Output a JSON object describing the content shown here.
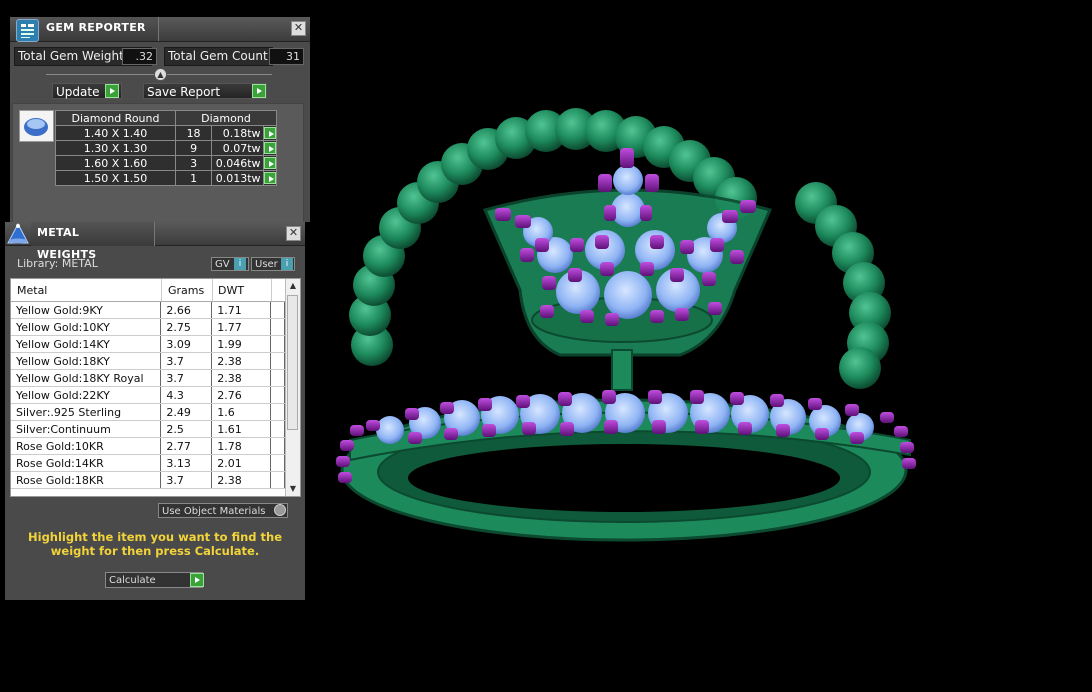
{
  "gem_reporter": {
    "title": "GEM REPORTER",
    "total_weight_label": "Total Gem Weight",
    "total_weight_value": ".32",
    "total_count_label": "Total Gem Count",
    "total_count_value": "31",
    "update_label": "Update",
    "save_label": "Save Report",
    "gem_shape": "Diamond Round",
    "gem_material": "Diamond",
    "rows": [
      {
        "size": "1.40 X 1.40",
        "count": "18",
        "weight": "0.18tw"
      },
      {
        "size": "1.30 X 1.30",
        "count": "9",
        "weight": "0.07tw"
      },
      {
        "size": "1.60 X 1.60",
        "count": "3",
        "weight": "0.046tw"
      },
      {
        "size": "1.50 X 1.50",
        "count": "1",
        "weight": "0.013tw"
      }
    ]
  },
  "metal_weights": {
    "title": "METAL WEIGHTS",
    "library_label": "Library: METAL",
    "gv_label": "GV",
    "user_label": "User",
    "columns": {
      "metal": "Metal",
      "grams": "Grams",
      "dwt": "DWT"
    },
    "rows": [
      {
        "metal": "Yellow Gold:9KY",
        "grams": "2.66",
        "dwt": "1.71"
      },
      {
        "metal": "Yellow Gold:10KY",
        "grams": "2.75",
        "dwt": "1.77"
      },
      {
        "metal": "Yellow Gold:14KY",
        "grams": "3.09",
        "dwt": "1.99"
      },
      {
        "metal": "Yellow Gold:18KY",
        "grams": "3.7",
        "dwt": "2.38"
      },
      {
        "metal": "Yellow Gold:18KY Royal",
        "grams": "3.7",
        "dwt": "2.38"
      },
      {
        "metal": "Yellow Gold:22KY",
        "grams": "4.3",
        "dwt": "2.76"
      },
      {
        "metal": "Silver:.925 Sterling",
        "grams": "2.49",
        "dwt": "1.6"
      },
      {
        "metal": "Silver:Continuum",
        "grams": "2.5",
        "dwt": "1.61"
      },
      {
        "metal": "Rose Gold:10KR",
        "grams": "2.77",
        "dwt": "1.78"
      },
      {
        "metal": "Rose Gold:14KR",
        "grams": "3.13",
        "dwt": "2.01"
      },
      {
        "metal": "Rose Gold:18KR",
        "grams": "3.7",
        "dwt": "2.38"
      }
    ],
    "use_object_materials_label": "Use Object Materials",
    "instruction": "Highlight the item you want to find the weight for then press Calculate.",
    "calculate_label": "Calculate"
  },
  "colors": {
    "metal_green": "#1f8a5c",
    "gem_blue": "#8fb4f4",
    "prong_purple": "#8a1fae",
    "instruction_yellow": "#f2d43a"
  }
}
